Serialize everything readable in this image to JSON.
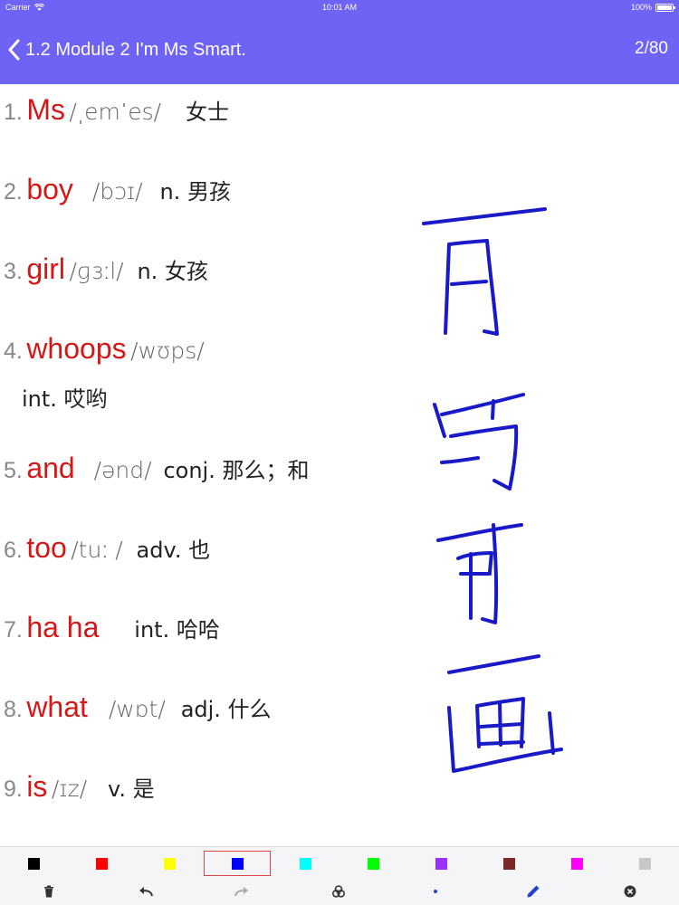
{
  "status_bar": {
    "carrier": "Carrier",
    "time": "10:01 AM",
    "battery": "100%"
  },
  "nav": {
    "title": "1.2 Module 2 I'm Ms Smart.",
    "counter": "2/80"
  },
  "words": [
    {
      "num": "1.",
      "en": "Ms",
      "ipa": "/ˌemˈes/",
      "zh": "女士"
    },
    {
      "num": "2.",
      "en": "boy",
      "ipa": "/bɔɪ/",
      "zh": "n. 男孩"
    },
    {
      "num": "3.",
      "en": "girl",
      "ipa": "/ɡɜːl/",
      "zh": "n. 女孩"
    },
    {
      "num": "4.",
      "en": "whoops",
      "ipa": "/wʊps/",
      "zh": "int. 哎哟"
    },
    {
      "num": "5.",
      "en": "and",
      "ipa": "/ənd/",
      "zh": "conj. 那么；和"
    },
    {
      "num": "6.",
      "en": "too",
      "ipa": "/tuː /",
      "zh": "adv. 也"
    },
    {
      "num": "7.",
      "en": "ha ha",
      "ipa": "",
      "zh": "int. 哈哈"
    },
    {
      "num": "8.",
      "en": "what",
      "ipa": "/wɒt/",
      "zh": "adj. 什么"
    },
    {
      "num": "9.",
      "en": "is",
      "ipa": "/ɪz/",
      "zh": "v. 是"
    }
  ],
  "palette": {
    "colors": [
      "#000000",
      "#ff0000",
      "#ffff00",
      "#0000ff",
      "#00ffff",
      "#00ff00",
      "#9b30ff",
      "#7a2a22",
      "#ff00ff",
      "#c8c8c8"
    ],
    "selected_index": 3
  },
  "toolbar": {
    "icons": [
      "trash-icon",
      "undo-icon",
      "redo-icon",
      "color-mix-icon",
      "brush-size-icon",
      "pen-icon",
      "close-circle-icon"
    ]
  },
  "ink": {
    "color": "#1919c8"
  }
}
